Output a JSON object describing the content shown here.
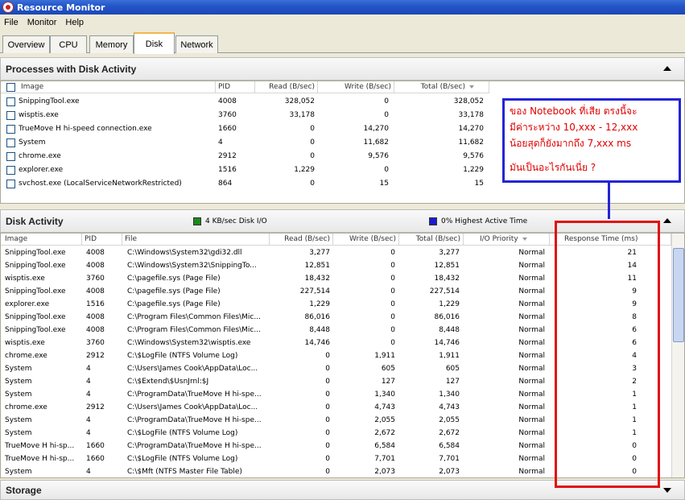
{
  "window": {
    "title": "Resource Monitor"
  },
  "menu": [
    "File",
    "Monitor",
    "Help"
  ],
  "tabs": [
    "Overview",
    "CPU",
    "Memory",
    "Disk",
    "Network"
  ],
  "active_tab": "Disk",
  "processes": {
    "title": "Processes with Disk Activity",
    "columns": [
      "Image",
      "PID",
      "Read (B/sec)",
      "Write (B/sec)",
      "Total (B/sec)"
    ],
    "rows": [
      {
        "image": "SnippingTool.exe",
        "pid": "4008",
        "read": "328,052",
        "write": "0",
        "total": "328,052"
      },
      {
        "image": "wisptis.exe",
        "pid": "3760",
        "read": "33,178",
        "write": "0",
        "total": "33,178"
      },
      {
        "image": "TrueMove H hi-speed connection.exe",
        "pid": "1660",
        "read": "0",
        "write": "14,270",
        "total": "14,270"
      },
      {
        "image": "System",
        "pid": "4",
        "read": "0",
        "write": "11,682",
        "total": "11,682"
      },
      {
        "image": "chrome.exe",
        "pid": "2912",
        "read": "0",
        "write": "9,576",
        "total": "9,576"
      },
      {
        "image": "explorer.exe",
        "pid": "1516",
        "read": "1,229",
        "write": "0",
        "total": "1,229"
      },
      {
        "image": "svchost.exe (LocalServiceNetworkRestricted)",
        "pid": "864",
        "read": "0",
        "write": "15",
        "total": "15"
      }
    ]
  },
  "disk_activity": {
    "title": "Disk Activity",
    "legend_io": "4 KB/sec Disk I/O",
    "legend_active": "0% Highest Active Time",
    "io_color": "#1a8a1a",
    "active_color": "#1a1ad0",
    "columns": [
      "Image",
      "PID",
      "File",
      "Read (B/sec)",
      "Write (B/sec)",
      "Total (B/sec)",
      "I/O Priority",
      "Response Time (ms)"
    ],
    "rows": [
      {
        "image": "SnippingTool.exe",
        "pid": "4008",
        "file": "C:\\Windows\\System32\\gdi32.dll",
        "read": "3,277",
        "write": "0",
        "total": "3,277",
        "priority": "Normal",
        "response": "21"
      },
      {
        "image": "SnippingTool.exe",
        "pid": "4008",
        "file": "C:\\Windows\\System32\\SnippingTo...",
        "read": "12,851",
        "write": "0",
        "total": "12,851",
        "priority": "Normal",
        "response": "14"
      },
      {
        "image": "wisptis.exe",
        "pid": "3760",
        "file": "C:\\pagefile.sys (Page File)",
        "read": "18,432",
        "write": "0",
        "total": "18,432",
        "priority": "Normal",
        "response": "11"
      },
      {
        "image": "SnippingTool.exe",
        "pid": "4008",
        "file": "C:\\pagefile.sys (Page File)",
        "read": "227,514",
        "write": "0",
        "total": "227,514",
        "priority": "Normal",
        "response": "9"
      },
      {
        "image": "explorer.exe",
        "pid": "1516",
        "file": "C:\\pagefile.sys (Page File)",
        "read": "1,229",
        "write": "0",
        "total": "1,229",
        "priority": "Normal",
        "response": "9"
      },
      {
        "image": "SnippingTool.exe",
        "pid": "4008",
        "file": "C:\\Program Files\\Common Files\\Mic...",
        "read": "86,016",
        "write": "0",
        "total": "86,016",
        "priority": "Normal",
        "response": "8"
      },
      {
        "image": "SnippingTool.exe",
        "pid": "4008",
        "file": "C:\\Program Files\\Common Files\\Mic...",
        "read": "8,448",
        "write": "0",
        "total": "8,448",
        "priority": "Normal",
        "response": "6"
      },
      {
        "image": "wisptis.exe",
        "pid": "3760",
        "file": "C:\\Windows\\System32\\wisptis.exe",
        "read": "14,746",
        "write": "0",
        "total": "14,746",
        "priority": "Normal",
        "response": "6"
      },
      {
        "image": "chrome.exe",
        "pid": "2912",
        "file": "C:\\$LogFile (NTFS Volume Log)",
        "read": "0",
        "write": "1,911",
        "total": "1,911",
        "priority": "Normal",
        "response": "4"
      },
      {
        "image": "System",
        "pid": "4",
        "file": "C:\\Users\\James Cook\\AppData\\Loc...",
        "read": "0",
        "write": "605",
        "total": "605",
        "priority": "Normal",
        "response": "3"
      },
      {
        "image": "System",
        "pid": "4",
        "file": "C:\\$Extend\\$UsnJrnl:$J",
        "read": "0",
        "write": "127",
        "total": "127",
        "priority": "Normal",
        "response": "2"
      },
      {
        "image": "System",
        "pid": "4",
        "file": "C:\\ProgramData\\TrueMove H hi-spe...",
        "read": "0",
        "write": "1,340",
        "total": "1,340",
        "priority": "Normal",
        "response": "1"
      },
      {
        "image": "chrome.exe",
        "pid": "2912",
        "file": "C:\\Users\\James Cook\\AppData\\Loc...",
        "read": "0",
        "write": "4,743",
        "total": "4,743",
        "priority": "Normal",
        "response": "1"
      },
      {
        "image": "System",
        "pid": "4",
        "file": "C:\\ProgramData\\TrueMove H hi-spe...",
        "read": "0",
        "write": "2,055",
        "total": "2,055",
        "priority": "Normal",
        "response": "1"
      },
      {
        "image": "System",
        "pid": "4",
        "file": "C:\\$LogFile (NTFS Volume Log)",
        "read": "0",
        "write": "2,672",
        "total": "2,672",
        "priority": "Normal",
        "response": "1"
      },
      {
        "image": "TrueMove H hi-sp...",
        "pid": "1660",
        "file": "C:\\ProgramData\\TrueMove H hi-spe...",
        "read": "0",
        "write": "6,584",
        "total": "6,584",
        "priority": "Normal",
        "response": "0"
      },
      {
        "image": "TrueMove H hi-sp...",
        "pid": "1660",
        "file": "C:\\$LogFile (NTFS Volume Log)",
        "read": "0",
        "write": "7,701",
        "total": "7,701",
        "priority": "Normal",
        "response": "0"
      },
      {
        "image": "System",
        "pid": "4",
        "file": "C:\\$Mft (NTFS Master File Table)",
        "read": "0",
        "write": "2,073",
        "total": "2,073",
        "priority": "Normal",
        "response": "0"
      }
    ]
  },
  "storage": {
    "title": "Storage"
  },
  "annotation": {
    "lines": [
      "ของ Notebook ที่เสีย ตรงนี้จะ",
      "มีค่าระหว่าง 10,xxx - 12,xxx",
      "น้อยสุดก็ยังมากถึง 7,xxx ms",
      "มันเป็นอะไรกันเนี่ย ?"
    ],
    "text_color": "#e00000",
    "box_color": "#2424d6",
    "highlight_color": "#e01010"
  }
}
